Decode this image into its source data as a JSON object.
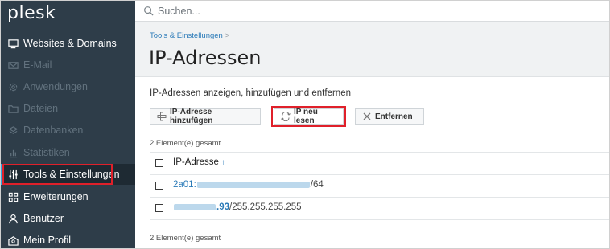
{
  "brand": {
    "logo_text": "plesk"
  },
  "search": {
    "placeholder": "Suchen..."
  },
  "sidebar": {
    "items": [
      {
        "label": "Websites & Domains",
        "icon": "monitor-icon"
      },
      {
        "label": "E-Mail",
        "icon": "mail-icon"
      },
      {
        "label": "Anwendungen",
        "icon": "gear-icon"
      },
      {
        "label": "Dateien",
        "icon": "folder-icon"
      },
      {
        "label": "Datenbanken",
        "icon": "database-icon"
      },
      {
        "label": "Statistiken",
        "icon": "bar-chart-icon"
      },
      {
        "label": "Tools & Einstellungen",
        "icon": "sliders-icon"
      },
      {
        "label": "Erweiterungen",
        "icon": "grid-icon"
      },
      {
        "label": "Benutzer",
        "icon": "user-icon"
      },
      {
        "label": "Mein Profil",
        "icon": "profile-icon"
      }
    ]
  },
  "header": {
    "breadcrumb": "Tools & Einstellungen",
    "breadcrumb_sep": ">",
    "title": "IP-Adressen"
  },
  "main": {
    "description": "IP-Adressen anzeigen, hinzufügen und entfernen",
    "toolbar": {
      "add_label": "IP-Adresse hinzufügen",
      "reread_label": "IP neu lesen",
      "remove_label": "Entfernen"
    },
    "count_top": "2 Element(e) gesamt",
    "count_bottom": "2 Element(e) gesamt",
    "table": {
      "column_header": "IP-Adresse",
      "sort_indicator": "↑",
      "rows": [
        {
          "ip_prefix": "2a01:",
          "ip_suffix": "/64"
        },
        {
          "ip_prefix": ".93",
          "ip_suffix": "/255.255.255.255"
        }
      ]
    }
  },
  "colors": {
    "sidebar_bg": "#2e3d49",
    "active_bg": "#1e2a33",
    "link": "#2a7ab8",
    "highlight_red": "#e0202a"
  }
}
